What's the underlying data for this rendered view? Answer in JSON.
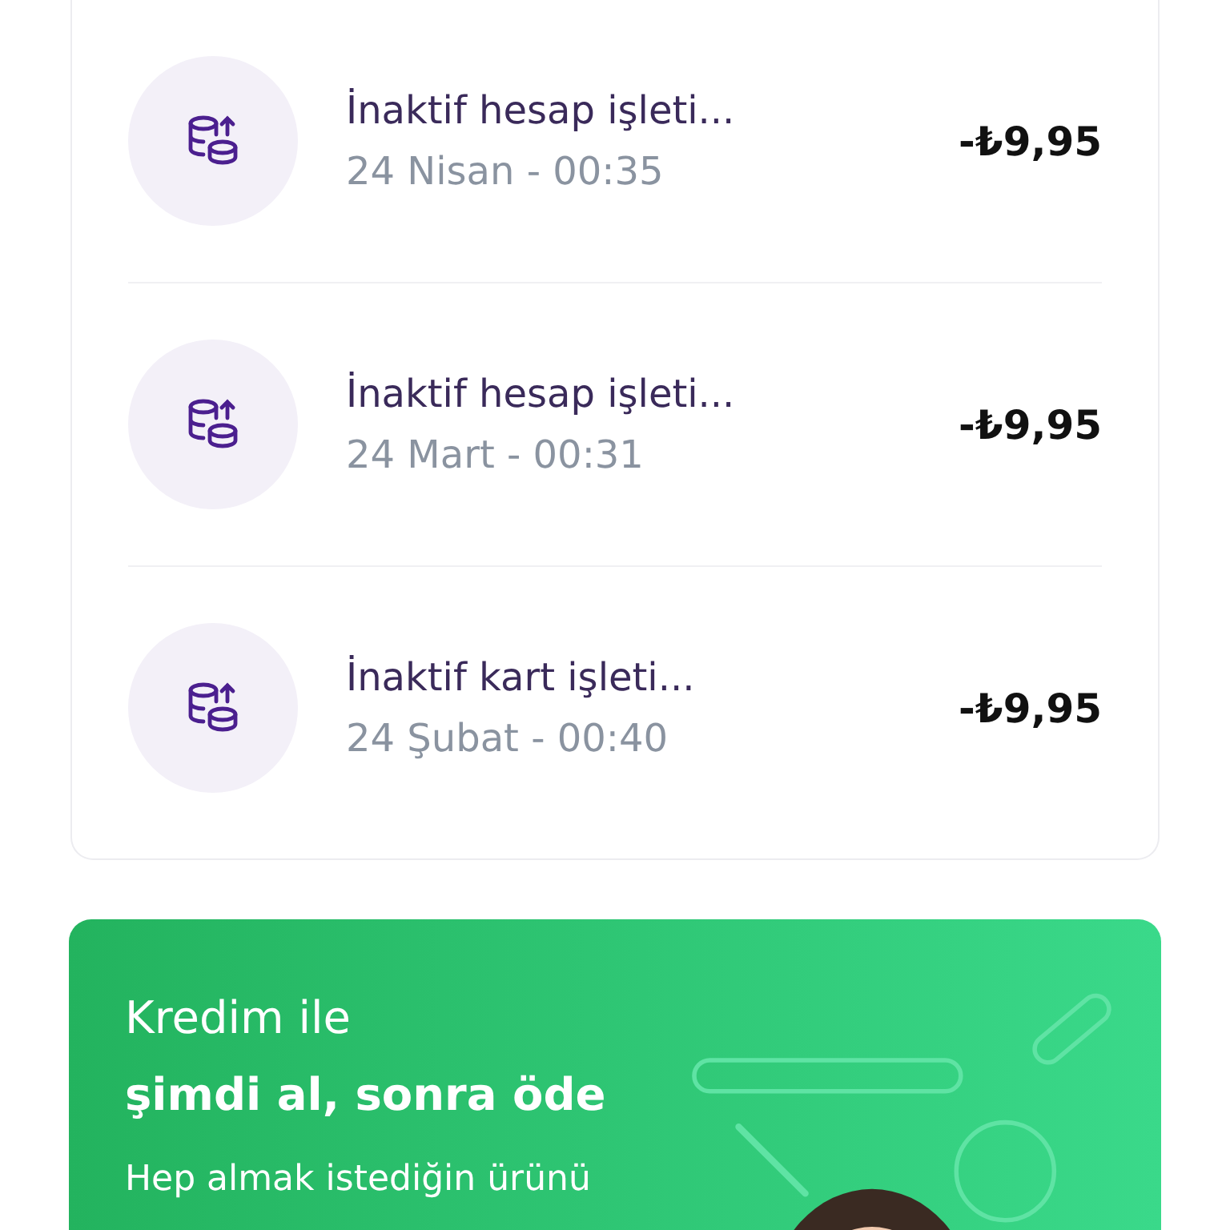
{
  "transactions": [
    {
      "title": "İnaktif hesap işleti...",
      "date": "24 Nisan - 00:35",
      "amount": "-₺9,95"
    },
    {
      "title": "İnaktif hesap işleti...",
      "date": "24 Mart - 00:31",
      "amount": "-₺9,95"
    },
    {
      "title": "İnaktif kart işleti...",
      "date": "24 Şubat - 00:40",
      "amount": "-₺9,95"
    }
  ],
  "promo": {
    "title_lines": [
      "Kredim ile",
      "şimdi al, sonra öde"
    ],
    "text": "Hep almak istediğin ürünü"
  }
}
